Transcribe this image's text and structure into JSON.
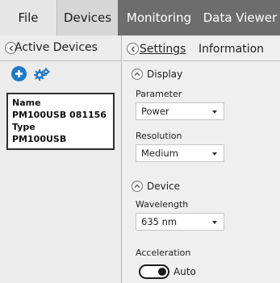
{
  "tabs": {
    "file": "File",
    "devices": "Devices",
    "monitoring": "Monitoring",
    "data_viewer": "Data Viewer"
  },
  "left_panel": {
    "title": "Active Devices",
    "add_icon": "plus-circle-icon",
    "scan_icon": "network-gears-icon",
    "device_card": {
      "name_label": "Name",
      "name_value": "PM100USB 081156",
      "type_label": "Type",
      "type_value": "PM100USB"
    }
  },
  "right_panel": {
    "tabs": {
      "settings": "Settings",
      "information": "Information"
    },
    "display_section": {
      "title": "Display",
      "parameter_label": "Parameter",
      "parameter_value": "Power",
      "resolution_label": "Resolution",
      "resolution_value": "Medium"
    },
    "device_section": {
      "title": "Device",
      "wavelength_label": "Wavelength",
      "wavelength_value": "635 nm",
      "acceleration_label": "Acceleration",
      "acceleration_mode": "Auto"
    }
  },
  "colors": {
    "tab_bar": "#6d6d6d",
    "accent_blue": "#1f7bc6"
  }
}
